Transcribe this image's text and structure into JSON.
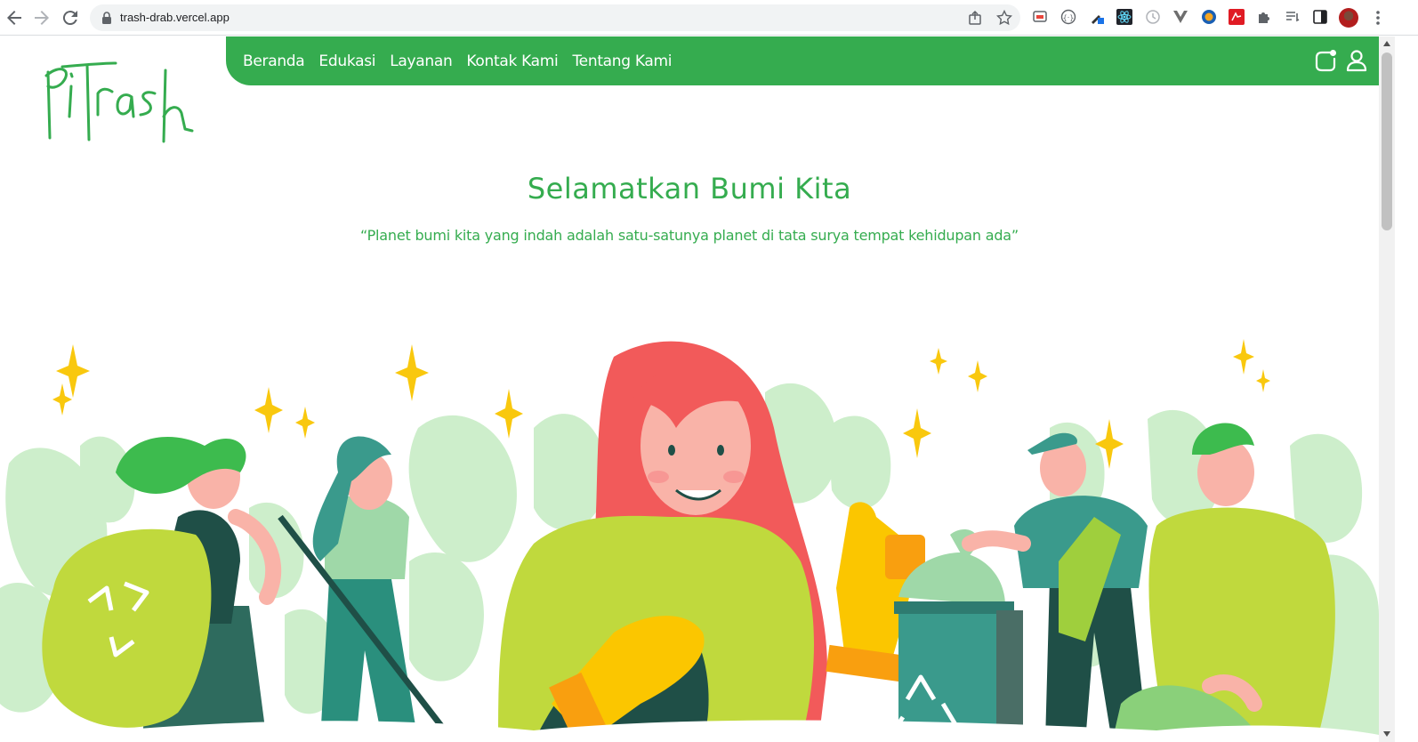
{
  "browser": {
    "url": "trash-drab.vercel.app"
  },
  "site": {
    "logo_text": "PiTrash"
  },
  "navbar": {
    "links": [
      "Beranda",
      "Edukasi",
      "Layanan",
      "Kontak Kami",
      "Tentang Kami"
    ]
  },
  "hero": {
    "title": "Selamatkan Bumi Kita",
    "subtitle": "“Planet bumi kita yang indah adalah satu-satunya planet di tata surya tempat kehidupan ada”"
  },
  "colors": {
    "brand_green": "#35ac4f",
    "lime": "#c0d93d",
    "teal": "#3a9a8c",
    "hair_red": "#f25a5a",
    "glove_yellow": "#fbc600",
    "sparkle": "#f9c80e"
  },
  "icons": {
    "back": "arrow-left-icon",
    "forward": "arrow-right-icon",
    "reload": "reload-icon",
    "share": "share-icon",
    "bookmark": "star-icon",
    "cart": "cart-icon",
    "user": "user-icon"
  }
}
